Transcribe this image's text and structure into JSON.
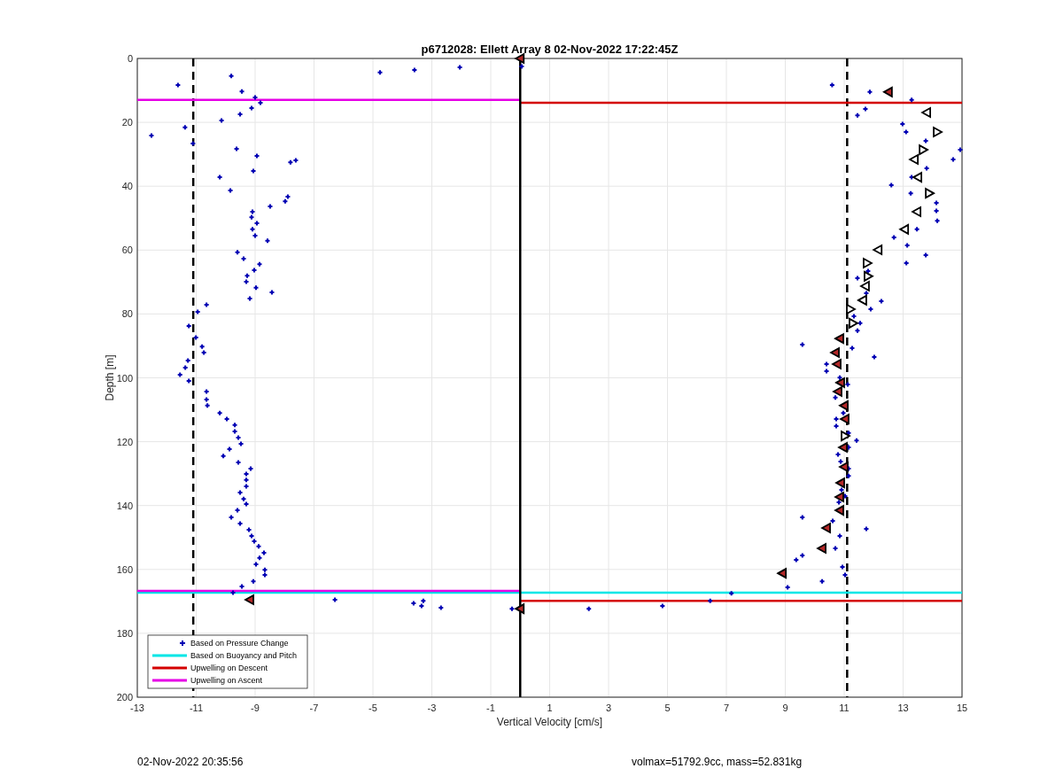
{
  "figure": {
    "chart_data": {
      "type": "scatter",
      "title": "p6712028: Ellett Array 8 02-Nov-2022 17:22:45Z",
      "xlabel": "Vertical Velocity [cm/s]",
      "ylabel": "Depth [m]",
      "xlim": [
        -13,
        15
      ],
      "ylim": [
        200,
        0
      ],
      "xticks": [
        -13,
        -11,
        -9,
        -7,
        -5,
        -3,
        -1,
        1,
        3,
        5,
        7,
        9,
        11,
        13,
        15
      ],
      "yticks": [
        0,
        20,
        40,
        60,
        80,
        100,
        120,
        140,
        160,
        180,
        200
      ],
      "series": [
        {
          "name": "Based on Pressure Change",
          "color": "#0000b4",
          "type": "scatter",
          "marker": "plus",
          "x": [
            -9.81,
            -11.62,
            -9.45,
            -9.0,
            -8.82,
            -9.12,
            -9.51,
            -10.14,
            -11.38,
            -12.52,
            -11.11,
            -9.63,
            -8.94,
            -9.06,
            -7.8,
            -7.62,
            -10.2,
            -9.84,
            -7.98,
            -7.89,
            -8.49,
            -9.09,
            -9.12,
            -8.94,
            -9.09,
            -9.0,
            -8.58,
            -9.6,
            -9.39,
            -8.85,
            -9.03,
            -9.27,
            -9.3,
            -8.97,
            -9.18,
            -8.43,
            -10.65,
            -10.95,
            -11.25,
            -11.01,
            -10.8,
            -10.74,
            -11.28,
            -11.37,
            -11.55,
            -11.25,
            -10.65,
            -10.65,
            -10.62,
            -10.2,
            -9.96,
            -9.69,
            -9.69,
            -9.57,
            -9.48,
            -9.87,
            -10.08,
            -9.57,
            -9.15,
            -9.3,
            -9.3,
            -9.3,
            -9.51,
            -9.39,
            -9.3,
            -9.6,
            -9.81,
            -9.51,
            -9.21,
            -9.12,
            -9.03,
            -8.88,
            -8.7,
            -8.85,
            -8.97,
            -8.67,
            -8.67,
            -9.06,
            -9.45,
            -9.75,
            -6.29,
            -3.62,
            -3.35,
            -3.29,
            -2.69,
            -0.28,
            -4.76,
            -3.59,
            -2.05,
            0.05,
            2.33,
            4.83,
            6.45,
            7.17,
            10.59,
            11.87,
            13.29,
            11.72,
            11.45,
            12.98,
            13.1,
            13.77,
            14.94,
            14.7,
            13.8,
            13.29,
            12.6,
            13.26,
            14.13,
            14.13,
            14.16,
            13.47,
            12.69,
            13.14,
            13.77,
            13.11,
            11.81,
            11.45,
            11.75,
            12.26,
            11.9,
            11.33,
            11.54,
            11.45,
            9.58,
            11.27,
            12.02,
            10.4,
            10.4,
            10.85,
            11.12,
            10.7,
            10.97,
            10.73,
            10.73,
            11.15,
            11.42,
            11.15,
            10.79,
            10.88,
            11.15,
            11.15,
            10.91,
            11.03,
            10.82,
            9.58,
            10.61,
            11.75,
            10.85,
            9.58,
            9.37,
            10.7,
            10.94,
            11.03,
            10.25,
            9.08
          ],
          "values": [
            5.5,
            8.3,
            10.3,
            12.2,
            13.9,
            15.5,
            17.5,
            19.4,
            21.6,
            24.1,
            26.6,
            28.3,
            30.5,
            35.2,
            32.5,
            31.9,
            37.2,
            41.3,
            44.7,
            43.3,
            46.3,
            48.0,
            49.7,
            51.6,
            53.5,
            55.5,
            57.1,
            60.7,
            62.7,
            64.4,
            66.3,
            68.0,
            69.9,
            71.8,
            75.2,
            73.2,
            77.1,
            79.3,
            83.8,
            87.4,
            90.2,
            92.1,
            94.6,
            96.8,
            99.0,
            101.0,
            104.3,
            106.8,
            108.7,
            111.0,
            112.9,
            114.8,
            116.8,
            118.7,
            120.7,
            122.3,
            124.5,
            126.5,
            128.4,
            130.1,
            132.0,
            134.0,
            135.9,
            137.9,
            139.5,
            141.5,
            143.7,
            145.6,
            147.6,
            149.5,
            151.2,
            152.8,
            154.8,
            156.4,
            158.4,
            160.1,
            161.7,
            163.7,
            165.3,
            167.3,
            169.5,
            170.6,
            171.4,
            169.8,
            172.0,
            172.3,
            4.4,
            3.6,
            2.8,
            2.5,
            172.3,
            171.4,
            169.8,
            167.5,
            8.3,
            10.5,
            13.0,
            15.8,
            17.8,
            20.5,
            23.0,
            25.8,
            28.6,
            31.6,
            34.4,
            37.2,
            39.7,
            42.2,
            45.2,
            47.7,
            50.8,
            53.5,
            56.0,
            58.5,
            61.6,
            64.1,
            66.6,
            68.8,
            73.5,
            76.0,
            78.5,
            80.7,
            82.9,
            85.2,
            89.6,
            90.7,
            93.5,
            95.7,
            97.9,
            99.9,
            102.1,
            106.2,
            111.0,
            112.9,
            115.1,
            117.3,
            119.6,
            121.8,
            124.0,
            126.2,
            128.4,
            130.7,
            135.1,
            137.0,
            139.0,
            143.7,
            144.8,
            147.3,
            149.5,
            155.6,
            157.0,
            153.4,
            159.2,
            161.7,
            163.7,
            165.6
          ]
        },
        {
          "name": "Based on Buoyancy and Pitch",
          "color": "#00e6e6",
          "type": "line",
          "x": [
            -13,
            15
          ],
          "values": [
            167.3,
            167.3
          ]
        },
        {
          "name": "Upwelling on Descent",
          "color": "#d40000",
          "type": "line",
          "x": [
            0,
            15
          ],
          "values": [
            13.9,
            13.9
          ]
        },
        {
          "color": "#d40000",
          "type": "line",
          "x": [
            0,
            15
          ],
          "values": [
            169.8,
            169.8
          ]
        },
        {
          "name": "Upwelling on Ascent",
          "color": "#e600e6",
          "type": "line",
          "x": [
            -13,
            0
          ],
          "values": [
            13.0,
            13.0
          ]
        },
        {
          "color": "#e600e6",
          "type": "line",
          "x": [
            -13,
            0
          ],
          "values": [
            166.7,
            166.7
          ]
        },
        {
          "color": "#000000",
          "type": "line",
          "x": [
            0,
            0
          ],
          "values": [
            0,
            200
          ]
        },
        {
          "color": "#ffffff",
          "type": "scatter",
          "marker": "triangle-left",
          "x": [
            13.8,
            13.38,
            13.5,
            13.47,
            13.05,
            12.15,
            11.72,
            11.63
          ],
          "values": [
            16.9,
            31.6,
            37.2,
            48.0,
            53.5,
            59.9,
            71.3,
            75.7
          ]
        },
        {
          "color": "#ffffff",
          "type": "scatter",
          "marker": "triangle-right",
          "x": [
            14.16,
            13.68,
            13.89,
            11.78,
            11.81,
            11.21,
            11.3,
            11.03
          ],
          "values": [
            23.0,
            28.6,
            42.2,
            64.1,
            68.2,
            78.5,
            82.9,
            118.2
          ]
        },
        {
          "color": "#b42828",
          "type": "scatter",
          "marker": "triangle-left",
          "x": [
            12.5,
            10.85,
            10.7,
            10.76,
            10.88,
            10.79,
            11.0,
            11.03,
            10.97,
            11.0,
            10.88,
            10.85,
            10.85,
            10.4,
            10.25,
            8.9,
            -9.18,
            0,
            0
          ],
          "values": [
            10.5,
            87.7,
            92.1,
            95.7,
            101.5,
            104.3,
            108.7,
            112.9,
            121.8,
            127.9,
            132.9,
            137.3,
            141.5,
            147.0,
            153.4,
            161.2,
            169.5,
            0,
            172.3
          ]
        }
      ],
      "ref_lines": [
        {
          "axis": "x",
          "value": -11.1
        },
        {
          "axis": "x",
          "value": 11.1
        }
      ],
      "grid": true,
      "legend": true
    }
  },
  "footer": {
    "timestamp": "02-Nov-2022 20:35:56",
    "info": "volmax=51792.9cc, mass=52.831kg"
  }
}
